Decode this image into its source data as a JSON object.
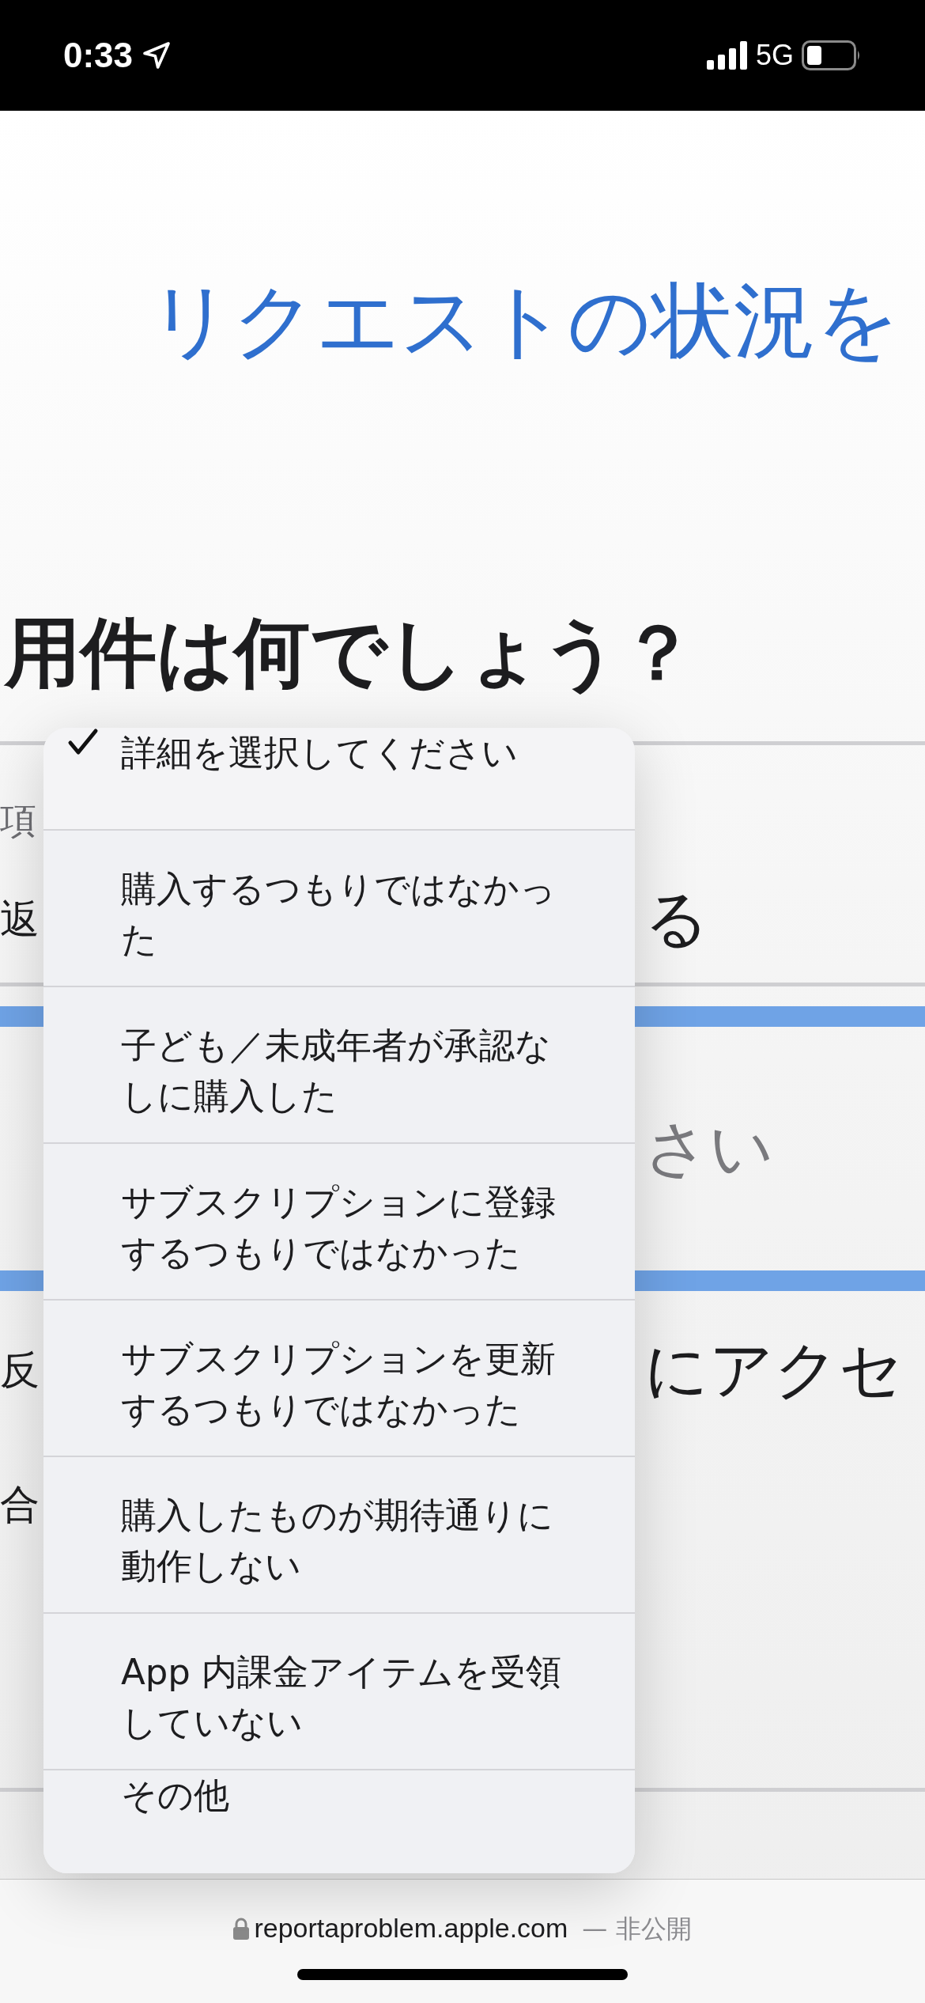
{
  "status_bar": {
    "time": "0:33",
    "network": "5G"
  },
  "page": {
    "heading": "リクエストの状況を",
    "question": "用件は何でしょう？",
    "rows": [
      {
        "kind": "label",
        "left": "項",
        "right": ""
      },
      {
        "kind": "value",
        "left": "返",
        "right": "る"
      },
      {
        "kind": "field",
        "left": "",
        "right": "さい"
      },
      {
        "kind": "value",
        "left": "反",
        "right": "にアクセ"
      },
      {
        "kind": "value",
        "left": "合",
        "right": ""
      }
    ]
  },
  "menu": {
    "items": [
      {
        "label": "詳細を選択してください",
        "selected": true
      },
      {
        "label": "購入するつもりではなかった",
        "selected": false
      },
      {
        "label": "子ども／未成年者が承認なしに購入した",
        "selected": false
      },
      {
        "label": "サブスクリプションに登録するつもりではなかった",
        "selected": false
      },
      {
        "label": "サブスクリプションを更新するつもりではなかった",
        "selected": false
      },
      {
        "label": "購入したものが期待通りに動作しない",
        "selected": false
      },
      {
        "label": "App 内課金アイテムを受領していない",
        "selected": false
      },
      {
        "label": "その他",
        "selected": false
      }
    ]
  },
  "address_bar": {
    "domain": "reportaproblem.apple.com",
    "note": "— 非公開"
  }
}
